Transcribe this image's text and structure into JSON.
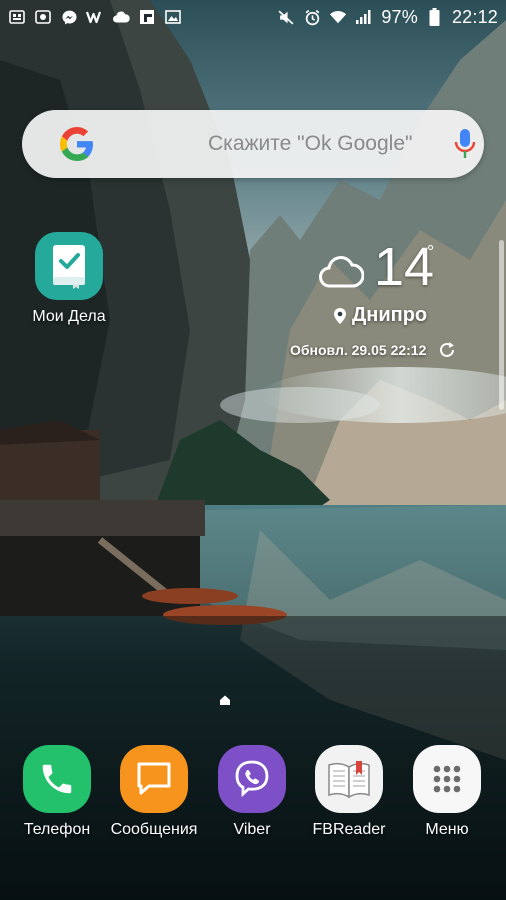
{
  "status_bar": {
    "left_icons": [
      "gallery-icon",
      "photo-icon",
      "messenger-icon",
      "w-app-icon",
      "weather-cloud-icon",
      "flipboard-icon",
      "image-icon"
    ],
    "right_icons": [
      "mute-icon",
      "alarm-icon",
      "wifi-icon",
      "signal-icon",
      "battery-icon"
    ],
    "battery": "97%",
    "time": "22:12"
  },
  "search": {
    "hint": "Скажите \"Ok Google\"",
    "google_colors": [
      "#4285F4",
      "#EA4335",
      "#FBBC05",
      "#34A853"
    ]
  },
  "apps": {
    "moi_dela": {
      "label": "Мои Дела",
      "icon": "checkbook-icon",
      "color": "#25a99a"
    }
  },
  "weather": {
    "icon": "cloud-icon",
    "temperature": "14",
    "degree": "°",
    "city": "Днипро",
    "updated": "Обновл. 29.05 22:12"
  },
  "dock": [
    {
      "label": "Телефон",
      "icon": "phone-icon",
      "color": "#23c16b"
    },
    {
      "label": "Сообщения",
      "icon": "message-icon",
      "color": "#f7941d"
    },
    {
      "label": "Viber",
      "icon": "viber-icon",
      "color": "#7d50c8"
    },
    {
      "label": "FBReader",
      "icon": "book-icon",
      "color": "#f2f2f2"
    },
    {
      "label": "Меню",
      "icon": "apps-grid-icon",
      "color": "#f7f7f7"
    }
  ]
}
